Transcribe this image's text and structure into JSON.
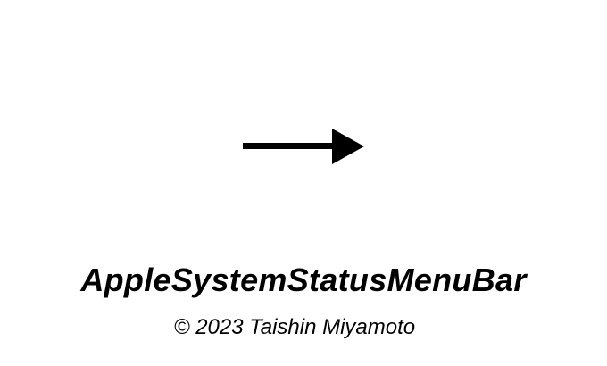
{
  "title": "AppleSystemStatusMenuBar",
  "copyright": "© 2023 Taishin Miyamoto",
  "icons": {
    "center": "arrow-right-icon"
  },
  "colors": {
    "background": "#ffffff",
    "foreground": "#000000"
  }
}
